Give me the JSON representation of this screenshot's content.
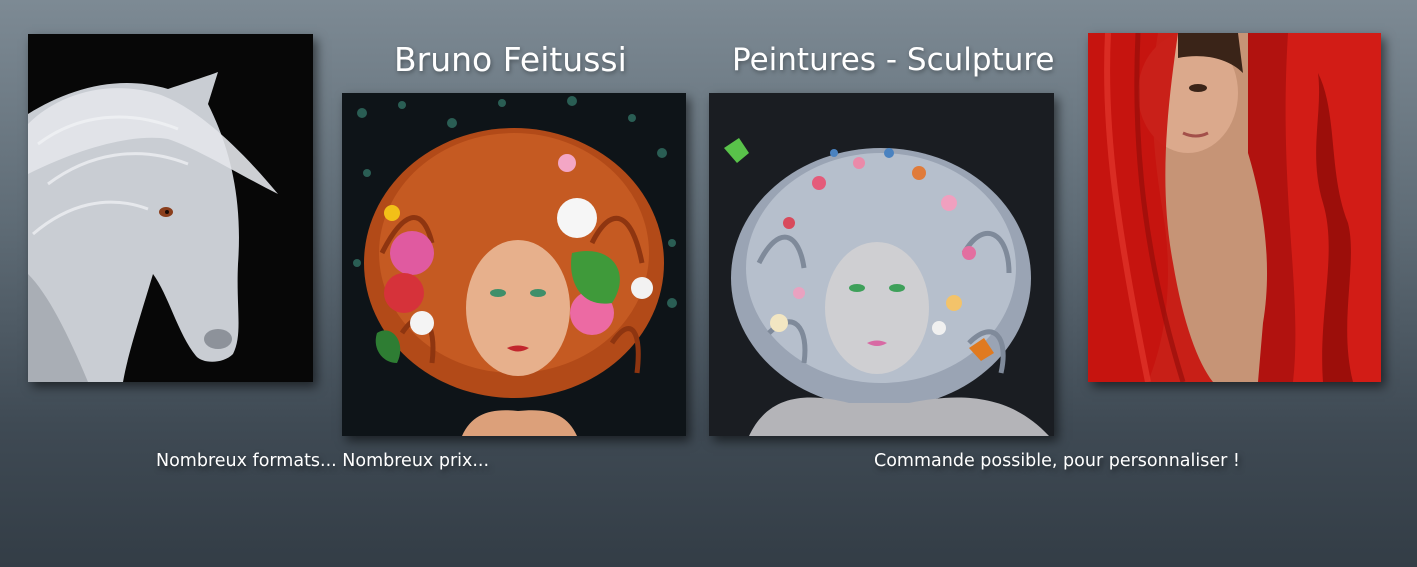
{
  "header": {
    "artist_name": "Bruno Feitussi",
    "subtitle": "Peintures - Sculpture"
  },
  "captions": {
    "left": "Nombreux formats... Nombreux prix...",
    "right": "Commande possible, pour personnaliser !"
  },
  "gallery": [
    {
      "subject": "white-horse-painting"
    },
    {
      "subject": "red-haired-woman-with-flowers-painting"
    },
    {
      "subject": "silver-haired-woman-with-flowers-painting"
    },
    {
      "subject": "woman-behind-red-veil-painting"
    }
  ],
  "colors": {
    "background_top": "#7d8a94",
    "background_bottom": "#333d46",
    "text": "#ffffff"
  }
}
